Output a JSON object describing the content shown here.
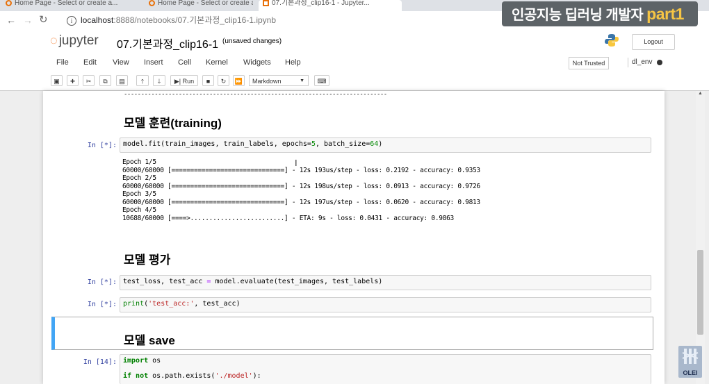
{
  "browser": {
    "tabs": [
      {
        "label": "Home Page - Select or create a..."
      },
      {
        "label": "Home Page - Select or create a..."
      },
      {
        "label": "07.기본과정_clip16-1 - Jupyter..."
      }
    ],
    "url_host": "localhost",
    "url_path": ":8888/notebooks/07.기본과정_clip16-1.ipynb"
  },
  "watermark": {
    "text": "인공지능 딥러닝 개발자 ",
    "accent": "part1"
  },
  "jupyter": {
    "logo_text": "jupyter",
    "notebook_name": "07.기본과정_clip16-1",
    "save_status": "(unsaved changes)",
    "logout_label": "Logout",
    "trust_label": "Not Trusted",
    "kernel_name": "dl_env",
    "menu": [
      "File",
      "Edit",
      "View",
      "Insert",
      "Cell",
      "Kernel",
      "Widgets",
      "Help"
    ],
    "toolbar": {
      "run_label": "Run",
      "cell_type": "Markdown"
    }
  },
  "notebook": {
    "heading_training": "모델 훈련(training)",
    "cell1_prompt": "In [*]:",
    "cell1_code": {
      "a": "model.fit(train_images, train_labels, epochs=",
      "b": "5",
      "c": ", batch_size=",
      "d": "64",
      "e": ")"
    },
    "output_lines": [
      "Epoch 1/5",
      "60000/60000 [==============================] - 12s 193us/step - loss: 0.2192 - accuracy: 0.9353",
      "Epoch 2/5",
      "60000/60000 [==============================] - 12s 198us/step - loss: 0.0913 - accuracy: 0.9726",
      "Epoch 3/5",
      "60000/60000 [==============================] - 12s 197us/step - loss: 0.0620 - accuracy: 0.9813",
      "Epoch 4/5",
      "10688/60000 [====>.........................] - ETA: 9s - loss: 0.0431 - accuracy: 0.9863"
    ],
    "heading_eval": "모델 평가",
    "cell2_prompt": "In [*]:",
    "cell2_code": {
      "a": "test_loss, test_acc ",
      "b": "=",
      "c": " model.evaluate(test_images, test_labels)"
    },
    "cell3_prompt": "In [*]:",
    "cell3_code": {
      "a": "print",
      "b": "(",
      "c": "'test_acc:'",
      "d": ", test_acc)"
    },
    "heading_save": "모델 save",
    "cell4_prompt": "In [14]:",
    "cell4_line1": {
      "kw": "import",
      "rest": " os"
    },
    "cell4_line2": {
      "kw": "if not",
      "rest": " os.path.exists(",
      "str": "'./model'",
      "end": "):"
    }
  },
  "brand_badge": "OLEI",
  "colors": {
    "accent_orange": "#f37726",
    "prompt_blue": "#303f9f",
    "selected_blue": "#42a5f5"
  }
}
